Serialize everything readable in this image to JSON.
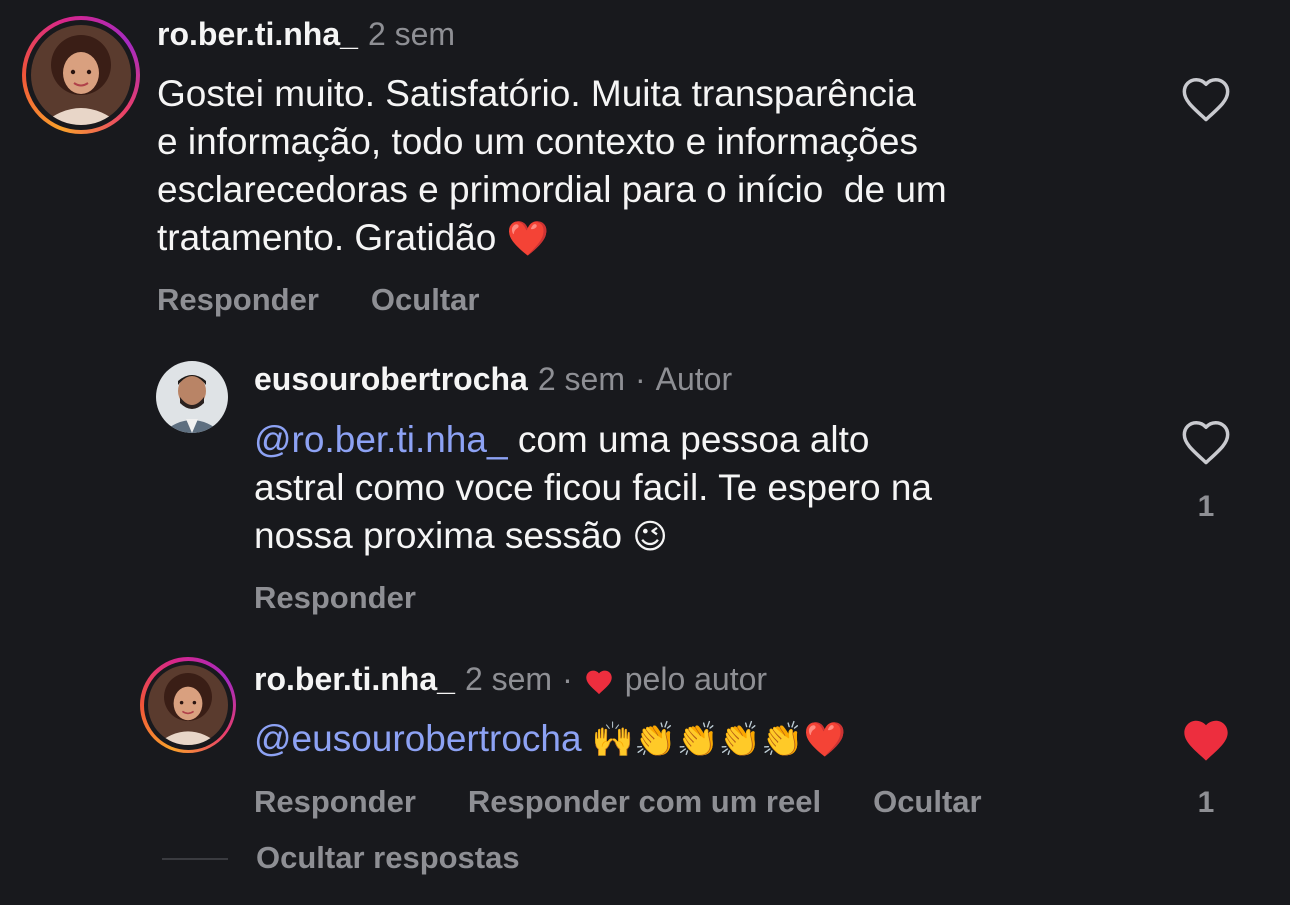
{
  "comments": [
    {
      "username": "ro.ber.ti.nha_",
      "time": "2 sem",
      "text_lines": [
        "Gostei muito. Satisfatório. Muita transparência",
        "e informação, todo um contexto e informações",
        "esclarecedoras e primordial para o início  de um",
        "tratamento. Gratidão"
      ],
      "end_emoji": "❤️",
      "actions": [
        "Responder",
        "Ocultar"
      ],
      "liked": false,
      "like_count": ""
    }
  ],
  "replies": [
    {
      "username": "eusourobertrocha",
      "time": "2 sem",
      "separator": "·",
      "badge": "Autor",
      "mention": "@ro.ber.ti.nha_",
      "text_first": " com uma pessoa alto",
      "text_lines": [
        "astral como voce ficou facil. Te espero na",
        "nossa proxima sessão"
      ],
      "end_emoji": "😉",
      "actions": [
        "Responder"
      ],
      "liked": false,
      "like_count": "1"
    },
    {
      "username": "ro.ber.ti.nha_",
      "time": "2 sem",
      "separator": "·",
      "liked_by_author_label": "pelo autor",
      "mention": "@eusourobertrocha",
      "emojis": "🙌👏👏👏👏❤️",
      "actions": [
        "Responder",
        "Responder com um reel",
        "Ocultar"
      ],
      "liked": true,
      "like_count": "1"
    }
  ],
  "hide_replies_label": "Ocultar respostas",
  "colors": {
    "background": "#18191d",
    "text": "#f5f5f5",
    "muted": "#8e8f94",
    "mention": "#8da2f4",
    "heart_red": "#ed2e3e"
  },
  "icons": {
    "like": "heart-outline-icon",
    "liked": "heart-filled-icon"
  }
}
